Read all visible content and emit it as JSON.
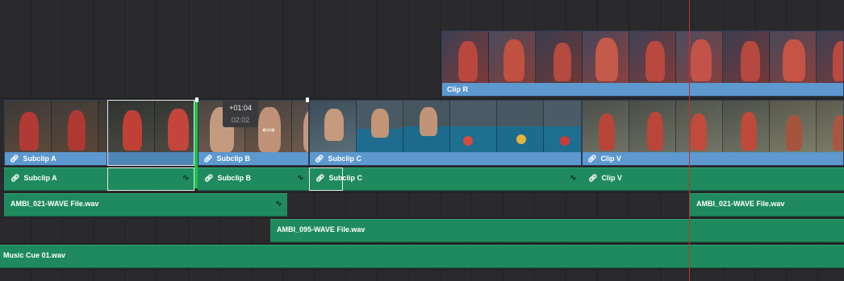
{
  "timeline": {
    "video_clips_top": [
      {
        "label": "Clip R"
      }
    ],
    "video_clips_main": [
      {
        "label": "Subclip A"
      },
      {
        "label": "Subclip B"
      },
      {
        "label": "Subclip C"
      },
      {
        "label": "Clip V"
      }
    ],
    "linked_audio": [
      {
        "label": "Subclip A"
      },
      {
        "label": "Subclip B"
      },
      {
        "label": "Subclip C"
      },
      {
        "label": "Clip V"
      }
    ],
    "audio_track_1": [
      {
        "label": "AMBI_021-WAVE File.wav"
      },
      {
        "label": "AMBI_021-WAVE File.wav"
      }
    ],
    "audio_track_2": [
      {
        "label": "AMBI_095-WAVE File.wav"
      }
    ],
    "audio_track_3": [
      {
        "label": "Music Cue 01.wav"
      }
    ],
    "trim_tooltip": {
      "offset": "+01:04",
      "duration": "02:02"
    }
  },
  "colors": {
    "video_bar": "#5d98cf",
    "audio_clip": "#1f8a5e",
    "trim_edge": "#1ec24a",
    "playhead": "#c9302c",
    "background": "#2a2a2c"
  },
  "icons": {
    "link": "link-icon",
    "fade": "fade-curve-icon",
    "trim_cursor": "trim-cursor-icon"
  }
}
